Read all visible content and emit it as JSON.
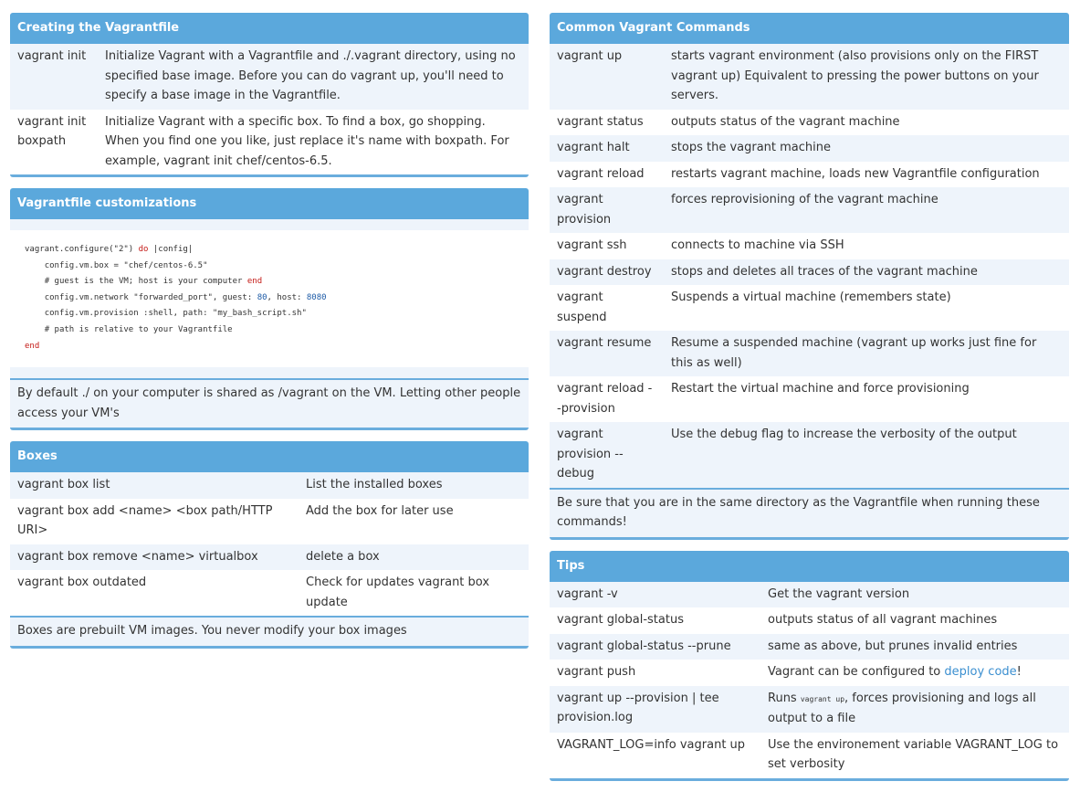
{
  "creating": {
    "title": "Creating the Vagrantfile",
    "rows": [
      {
        "cmd": "vagrant init",
        "desc": "Initialize Vagrant with a Vagrantfile and ./.vagrant directory, using no specified base image. Before you can do vagrant up, you'll need to specify a base image in the Vagrantfile."
      },
      {
        "cmd": "vagrant init boxpath",
        "desc": "Initialize Vagrant with a specific box. To find a box, go shopping. When you find one you like, just replace it's name with boxpath. For example, vagrant init chef/centos-6.5."
      }
    ]
  },
  "customizations": {
    "title": "Vagrantfile customizations",
    "code": {
      "l1a": "vagrant.configure(\"2\") ",
      "l1kw": "do",
      "l1b": " |config|",
      "l2": "config.vm.box = \"chef/centos-6.5\"",
      "l3a": "# guest is the VM; host is your computer ",
      "l3kw": "end",
      "l4a": "config.vm.network \"forwarded_port\", guest: ",
      "l4n1": "80",
      "l4b": ", host: ",
      "l4n2": "8080",
      "l5": "config.vm.provision :shell, path: \"my_bash_script.sh\"",
      "l6": "# path is relative to your Vagrantfile",
      "l7kw": "end"
    },
    "note": "By default ./ on your computer is shared as /vagrant on the VM. Letting other people access your VM's"
  },
  "boxes": {
    "title": "Boxes",
    "rows": [
      {
        "cmd": "vagrant box list",
        "desc": "List the installed boxes"
      },
      {
        "cmd": "vagrant box add <name> <box path/HTTP URI>",
        "desc": "Add the box for later use"
      },
      {
        "cmd": "vagrant box remove <name> virtualbox",
        "desc": "delete a box"
      },
      {
        "cmd": "vagrant box outdated",
        "desc": "Check for updates vagrant box update"
      }
    ],
    "note": "Boxes are prebuilt VM images. You never modify your box images"
  },
  "commands": {
    "title": "Common Vagrant Commands",
    "rows": [
      {
        "cmd": "vagrant up",
        "desc": "starts vagrant environment (also provisions only on the FIRST vagrant up) Equivalent to pressing the power buttons on your servers."
      },
      {
        "cmd": "vagrant status",
        "desc": "outputs status of the vagrant machine"
      },
      {
        "cmd": "vagrant halt",
        "desc": "stops the vagrant machine"
      },
      {
        "cmd": "vagrant reload",
        "desc": "restarts vagrant machine, loads new Vagrantfile configuration"
      },
      {
        "cmd": "vagrant provision",
        "desc": "forces reprovisioning of the vagrant machine"
      },
      {
        "cmd": "vagrant ssh",
        "desc": "connects to machine via SSH"
      },
      {
        "cmd": "vagrant destroy",
        "desc": "stops and deletes all traces of the vagrant machine"
      },
      {
        "cmd": "vagrant suspend",
        "desc": "Suspends a virtual machine (remembers state)"
      },
      {
        "cmd": "vagrant resume",
        "desc": "Resume a suspended machine (vagrant up works just fine for this as well)"
      },
      {
        "cmd": "vagrant reload --provision",
        "desc": "Restart the virtual machine and force provisioning"
      },
      {
        "cmd": "vagrant provision --debug",
        "desc": "Use the debug flag to increase the verbosity of the output"
      }
    ],
    "note": "Be sure that you are in the same directory as the Vagrantfile when running these commands!"
  },
  "tips": {
    "title": "Tips",
    "rows": [
      {
        "cmd": "vagrant -v",
        "desc": "Get the vagrant version"
      },
      {
        "cmd": "vagrant global-status",
        "desc": "outputs status of all vagrant machines"
      },
      {
        "cmd": "vagrant global-status --prune",
        "desc": "same as above, but prunes invalid entries"
      }
    ],
    "push": {
      "cmd": "vagrant push",
      "desc_pre": "Vagrant can be configured to ",
      "link": "deploy code",
      "desc_post": "!"
    },
    "provlog": {
      "cmd": "vagrant up --provision | tee provision.log",
      "desc_pre": "Runs ",
      "code": "vagrant up",
      "desc_post": ", forces provisioning and logs all output to a file"
    },
    "log": {
      "cmd": "VAGRANT_LOG=info vagrant up",
      "desc": "Use the environement variable VAGRANT_LOG to set verbosity"
    }
  }
}
